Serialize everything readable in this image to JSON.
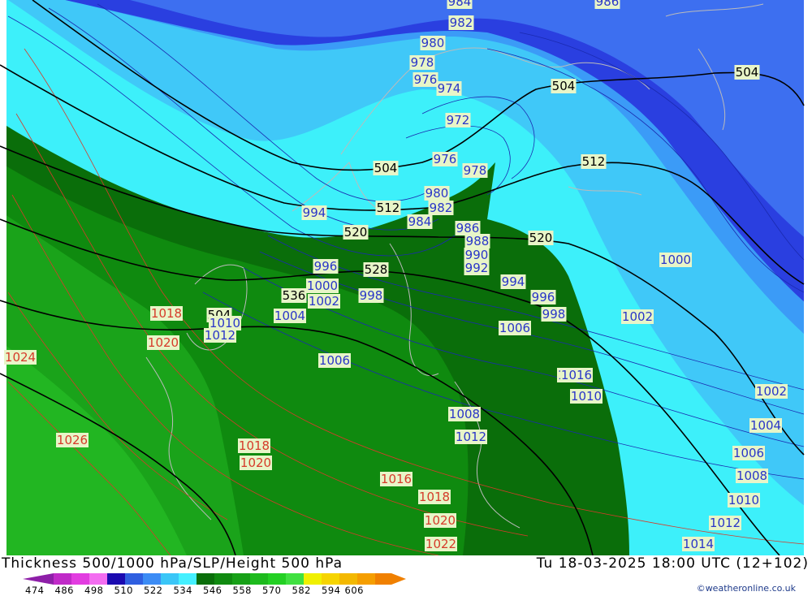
{
  "title": "Thickness 500/1000 hPa/SLP/Height 500 hPa",
  "valid_time": "Tu 18-03-2025 18:00 UTC (12+102)",
  "credit": "©weatheronline.co.uk",
  "legend": {
    "tick_labels": [
      "474",
      "486",
      "498",
      "510",
      "522",
      "534",
      "546",
      "558",
      "570",
      "582",
      "594",
      "606"
    ],
    "colors": [
      "#8e1fa8",
      "#c02ac8",
      "#e23ce0",
      "#f36df0",
      "#1b0ab0",
      "#2f5fe0",
      "#3c8cf5",
      "#3ac6f7",
      "#45f0ff",
      "#0a6e0a",
      "#108a10",
      "#17a017",
      "#1dba1d",
      "#23d023",
      "#40e040",
      "#f0f000",
      "#f6d400",
      "#f3b800",
      "#f59e00",
      "#f08000"
    ],
    "fill_colors": {
      "band_510": "#2a3fe0",
      "band_516": "#3d6ff0",
      "band_522": "#3b9bf7",
      "band_528": "#40c8f8",
      "band_534": "#3df0fa",
      "band_540": "#0a6e0a",
      "band_546": "#0f8a0f",
      "band_552": "#1aa31a",
      "band_558": "#22b622"
    },
    "line_colors": {
      "height": "#000000",
      "slp_low": "#1a2ab0",
      "slp_high": "#d63b2a",
      "coast": "#bbbbbb"
    }
  },
  "labels": {
    "height": [
      "504",
      "504",
      "504",
      "512",
      "512",
      "520",
      "520",
      "528",
      "536",
      "504"
    ],
    "slp_low": [
      "984",
      "986",
      "982",
      "980",
      "978",
      "976",
      "974",
      "972",
      "976",
      "978",
      "980",
      "982",
      "984",
      "986",
      "988",
      "990",
      "992",
      "994",
      "994",
      "996",
      "998",
      "996",
      "998",
      "1000",
      "1002",
      "1004",
      "1006",
      "1008",
      "1010",
      "1012",
      "1000",
      "1002",
      "1006",
      "1010",
      "1012",
      "1000",
      "1002",
      "1004",
      "1006",
      "1008",
      "1010",
      "1012",
      "1014",
      "1016"
    ],
    "slp_high": [
      "1018",
      "1020",
      "1024",
      "1026",
      "1018",
      "1020",
      "1016",
      "1018",
      "1020",
      "1022"
    ]
  }
}
